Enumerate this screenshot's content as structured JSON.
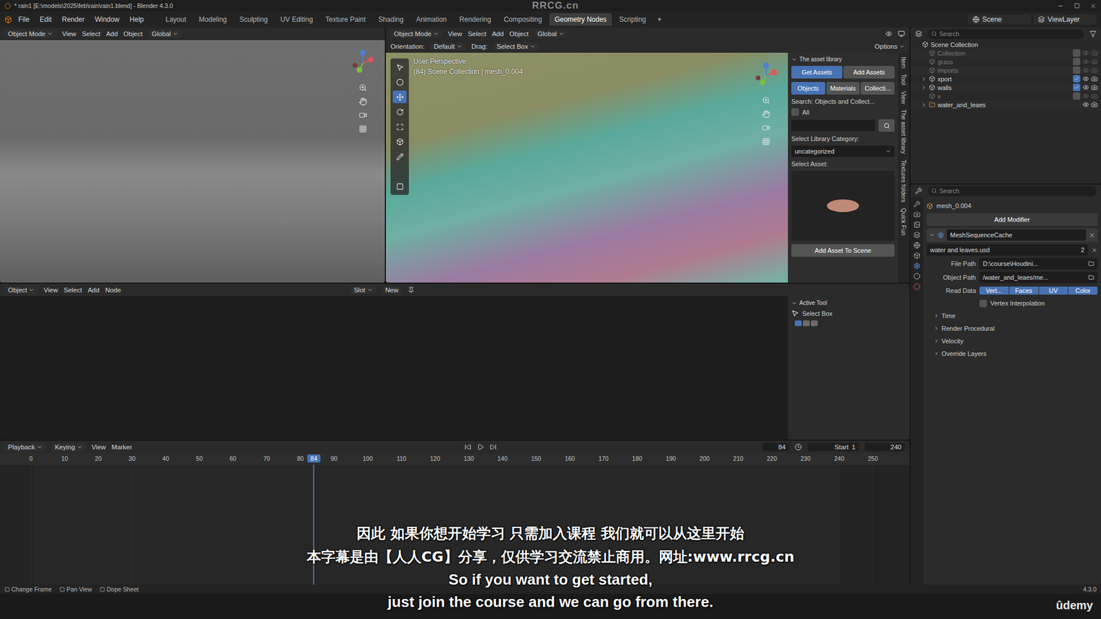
{
  "window": {
    "title": "* rain1 [E:\\models\\2025\\feb\\rain\\rain1.blend] - Blender 4.3.0",
    "watermark": "RRCG.cn"
  },
  "menu": [
    "File",
    "Edit",
    "Render",
    "Window",
    "Help"
  ],
  "workspaces": [
    {
      "label": "Layout",
      "selected": false
    },
    {
      "label": "Modeling",
      "selected": false
    },
    {
      "label": "Sculpting",
      "selected": false
    },
    {
      "label": "UV Editing",
      "selected": false
    },
    {
      "label": "Texture Paint",
      "selected": false
    },
    {
      "label": "Shading",
      "selected": false
    },
    {
      "label": "Animation",
      "selected": false
    },
    {
      "label": "Rendering",
      "selected": false
    },
    {
      "label": "Compositing",
      "selected": false
    },
    {
      "label": "Geometry Nodes",
      "selected": true
    },
    {
      "label": "Scripting",
      "selected": false
    }
  ],
  "workspace_add": "+",
  "scene": "Scene",
  "view_layer": "ViewLayer",
  "viewport_left": {
    "header": [
      {
        "label": "Object Mode",
        "kind": "dropdown"
      },
      {
        "label": "View",
        "kind": "menu"
      },
      {
        "label": "Select",
        "kind": "menu"
      },
      {
        "label": "Add",
        "kind": "menu"
      },
      {
        "label": "Object",
        "kind": "menu"
      },
      {
        "label": "Global",
        "kind": "dropdown"
      }
    ]
  },
  "viewport_right": {
    "header": [
      {
        "label": "Object Mode",
        "kind": "dropdown"
      },
      {
        "label": "View",
        "kind": "menu"
      },
      {
        "label": "Select",
        "kind": "menu"
      },
      {
        "label": "Add",
        "kind": "menu"
      },
      {
        "label": "Object",
        "kind": "menu"
      },
      {
        "label": "Global",
        "kind": "dropdown"
      }
    ],
    "orientation_row": [
      {
        "label": "Orientation:",
        "kind": "label"
      },
      {
        "label": "Default",
        "kind": "dropdown"
      },
      {
        "label": "Drag:",
        "kind": "label"
      },
      {
        "label": "Select Box",
        "kind": "dropdown"
      }
    ],
    "options": "Options",
    "overlay": [
      "User Perspective",
      "(84) Scene Collection | mesh_0.004"
    ]
  },
  "side_tabs": [
    "Item",
    "Tool",
    "View",
    "The asset library",
    "Textures folders",
    "Quick Fun"
  ],
  "asset_panel": {
    "title": "The asset library",
    "buttons": [
      {
        "label": "Get Assets",
        "selected": true
      },
      {
        "label": "Add Assets",
        "selected": false
      }
    ],
    "tabs": [
      {
        "label": "Objects",
        "selected": true
      },
      {
        "label": "Materials",
        "selected": false
      },
      {
        "label": "Collecti...",
        "selected": false
      }
    ],
    "search_label": "Search: Objects and Collect...",
    "all": {
      "label": "All",
      "checked": false
    },
    "search_value": "",
    "category_label": "Select Library Category:",
    "category": "uncategorized",
    "asset_label": "Select Asset:",
    "add_button": "Add Asset To Scene"
  },
  "node_editor": {
    "header": [
      {
        "label": "Object",
        "kind": "dropdown"
      },
      {
        "label": "View",
        "kind": "menu"
      },
      {
        "label": "Select",
        "kind": "menu"
      },
      {
        "label": "Add",
        "kind": "menu"
      },
      {
        "label": "Node",
        "kind": "menu"
      }
    ],
    "slot": "Slot",
    "new_button": "New",
    "active_tool": {
      "title": "Active Tool",
      "tool": "Select Box"
    }
  },
  "timeline": {
    "header": [
      {
        "label": "Playback",
        "kind": "dropdown"
      },
      {
        "label": "Keying",
        "kind": "dropdown"
      },
      {
        "label": "View",
        "kind": "menu"
      },
      {
        "label": "Marker",
        "kind": "menu"
      }
    ],
    "current_frame": "84",
    "start_label": "Start",
    "start": "1",
    "end": "240",
    "ticks": [
      "0",
      "10",
      "20",
      "30",
      "40",
      "50",
      "60",
      "70",
      "80",
      "90",
      "100",
      "110",
      "120",
      "130",
      "140",
      "150",
      "160",
      "170",
      "180",
      "190",
      "200",
      "210",
      "220",
      "230",
      "240",
      "250"
    ]
  },
  "status_bar": {
    "hints": [
      "Change Frame",
      "Pan View",
      "Dope Sheet"
    ],
    "version": "4.3.0"
  },
  "outliner": {
    "search": "Search",
    "items": [
      {
        "label": "Scene Collection",
        "kind": "scene",
        "depth": 0,
        "expandable": false,
        "enabled": true
      },
      {
        "label": "Collection",
        "kind": "collection",
        "depth": 1,
        "expandable": false,
        "enabled": false
      },
      {
        "label": "grass",
        "kind": "collection",
        "depth": 1,
        "expandable": false,
        "enabled": false
      },
      {
        "label": "imports",
        "kind": "collection",
        "depth": 1,
        "expandable": false,
        "enabled": false
      },
      {
        "label": "xport",
        "kind": "collection",
        "depth": 1,
        "expandable": true,
        "enabled": true
      },
      {
        "label": "walls",
        "kind": "collection",
        "depth": 1,
        "expandable": true,
        "enabled": true
      },
      {
        "label": "x",
        "kind": "collection",
        "depth": 1,
        "expandable": false,
        "enabled": false
      },
      {
        "label": "water_and_leaes",
        "kind": "object",
        "depth": 1,
        "expandable": true,
        "enabled": true
      }
    ]
  },
  "properties": {
    "search": "Search",
    "object": "mesh_0.004",
    "add_modifier": "Add Modifier",
    "modifier": {
      "name": "MeshSequenceCache",
      "cache_file": "water and leaves.usd",
      "users": "2",
      "fields": [
        {
          "label": "File Path",
          "value": "D:\\course\\Houdini..."
        },
        {
          "label": "Object Path",
          "value": "/water_and_leaes/me..."
        }
      ],
      "read_data": {
        "label": "Read Data",
        "options": [
          {
            "label": "Vert...",
            "selected": true
          },
          {
            "label": "Faces",
            "selected": true
          },
          {
            "label": "UV",
            "selected": true
          },
          {
            "label": "Color",
            "selected": true
          }
        ]
      },
      "vertex_interpolation": {
        "label": "Vertex Interpolation",
        "checked": false
      },
      "sections": [
        "Time",
        "Render Procedural",
        "Velocity",
        "Override Layers"
      ]
    }
  },
  "subtitles": [
    "因此 如果你想开始学习 只需加入课程 我们就可以从这里开始",
    "本字幕是由【人人CG】分享，仅供学习交流禁止商用。网址:www.rrcg.cn",
    "So if you want to get started,",
    "just join the course and we can go from there."
  ],
  "brand": "ûdemy"
}
